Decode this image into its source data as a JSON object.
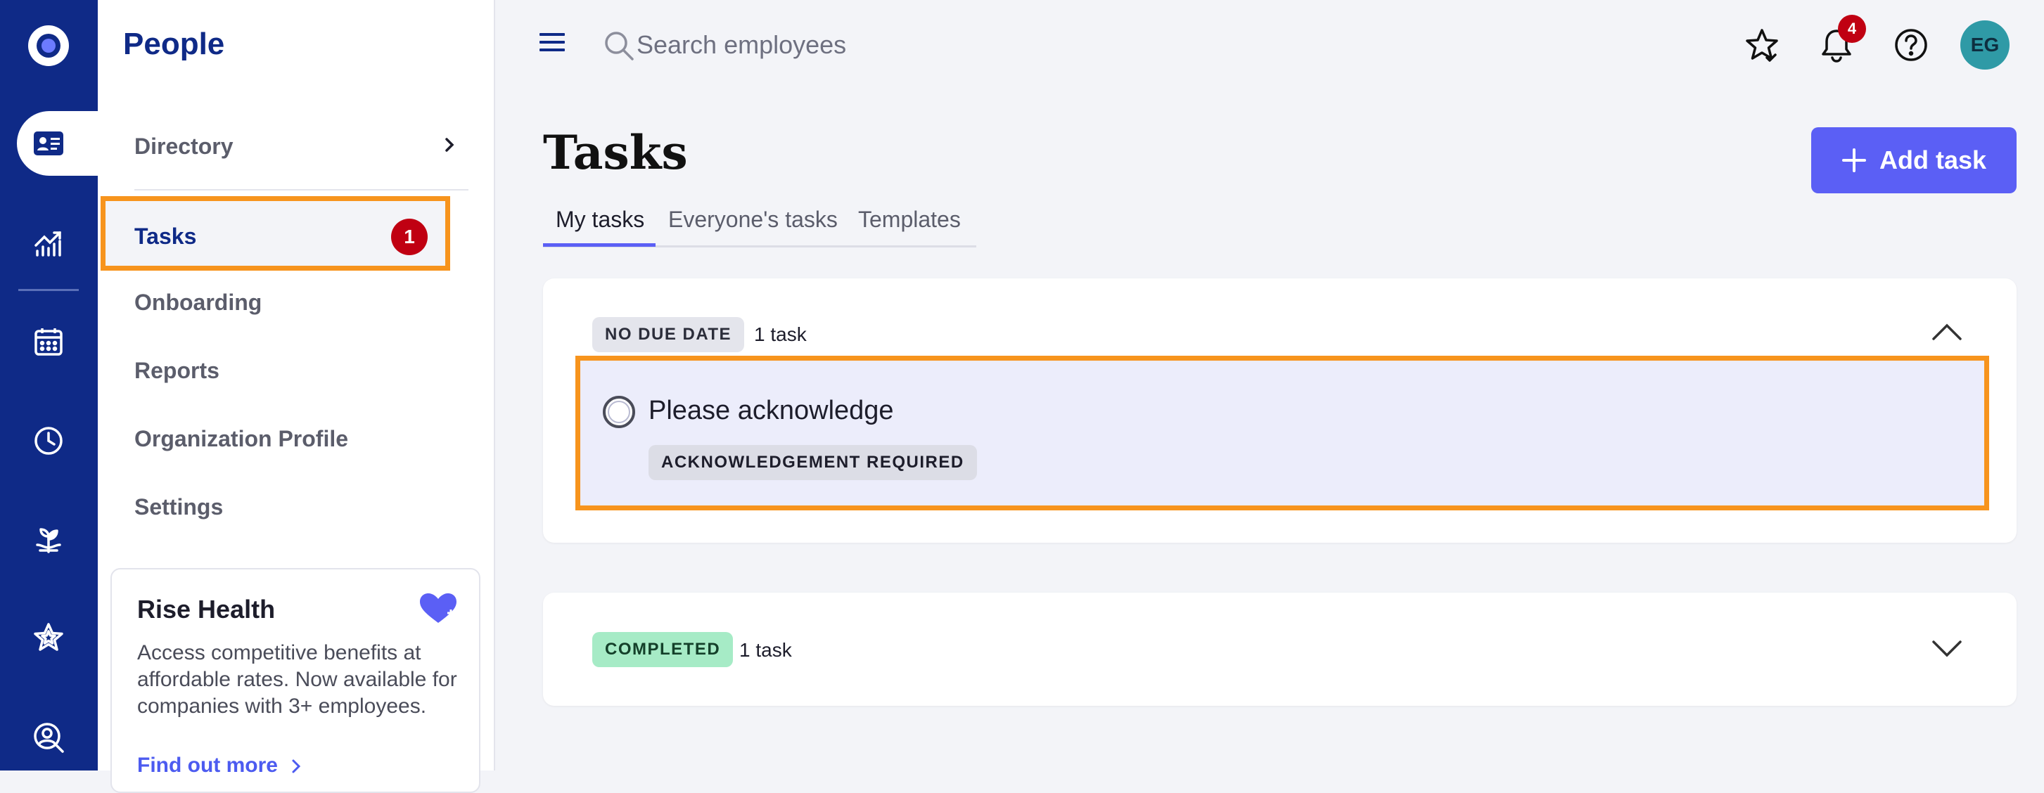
{
  "app": {
    "section_title": "People"
  },
  "rail": {
    "items": [
      {
        "name": "logo",
        "icon": "logo-icon"
      },
      {
        "name": "people",
        "icon": "id-card-icon",
        "active": true
      },
      {
        "name": "analytics",
        "icon": "trend-chart-icon"
      },
      {
        "name": "calendar",
        "icon": "calendar-icon"
      },
      {
        "name": "time",
        "icon": "clock-icon"
      },
      {
        "name": "benefits",
        "icon": "sprout-icon"
      },
      {
        "name": "recognition",
        "icon": "star-icon"
      },
      {
        "name": "search-people",
        "icon": "person-search-icon"
      }
    ]
  },
  "sidebar": {
    "items": [
      {
        "label": "Directory"
      },
      {
        "label": "Tasks",
        "badge": "1",
        "active": true
      },
      {
        "label": "Onboarding"
      },
      {
        "label": "Reports"
      },
      {
        "label": "Organization Profile"
      },
      {
        "label": "Settings"
      }
    ],
    "promo": {
      "title": "Rise Health",
      "body": "Access competitive benefits at affordable rates. Now available for companies with 3+ employees.",
      "link": "Find out more"
    }
  },
  "topbar": {
    "search_placeholder": "Search employees",
    "notifications_count": "4",
    "avatar_initials": "EG"
  },
  "page": {
    "title": "Tasks",
    "add_button": "Add task",
    "tabs": [
      {
        "label": "My tasks",
        "active": true
      },
      {
        "label": "Everyone's tasks"
      },
      {
        "label": "Templates"
      }
    ]
  },
  "groups": [
    {
      "label": "NO DUE DATE",
      "count": "1 task",
      "expanded": true,
      "tasks": [
        {
          "title": "Please acknowledge",
          "tag": "ACKNOWLEDGEMENT REQUIRED"
        }
      ]
    },
    {
      "label": "COMPLETED",
      "count": "1 task",
      "expanded": false
    }
  ],
  "colors": {
    "rail": "#0f2a87",
    "accent": "#5b5ff5",
    "highlight": "#f7941d",
    "badge": "#c00012",
    "completed": "#a6ebc6"
  }
}
